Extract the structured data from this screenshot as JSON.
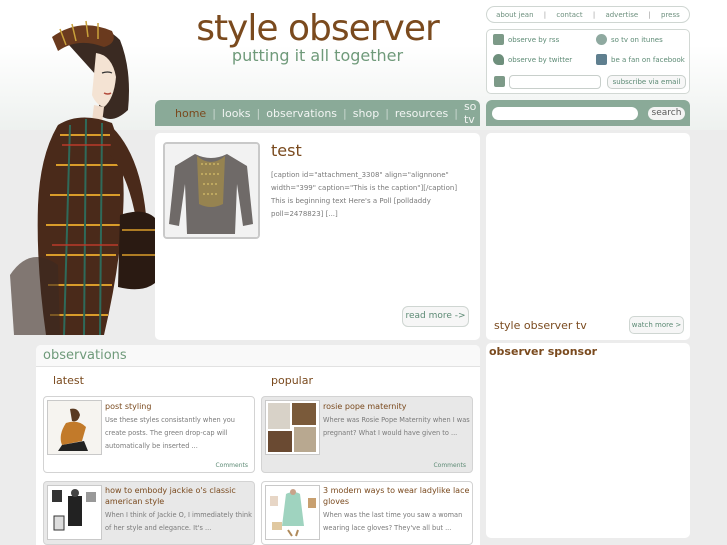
{
  "site": {
    "title": "style observer",
    "tagline": "putting it all together"
  },
  "top_links": [
    "about jean",
    "contact",
    "advertise",
    "press"
  ],
  "social": {
    "rss": "observe by rss",
    "itunes": "so tv on itunes",
    "twitter": "observe by twitter",
    "facebook": "be a fan on facebook",
    "subscribe_button": "subscribe via email"
  },
  "nav": {
    "items": [
      "home",
      "looks",
      "observations",
      "shop",
      "resources",
      "so tv"
    ],
    "active": "home"
  },
  "search": {
    "button": "search"
  },
  "featured": {
    "title": "test",
    "excerpt": "[caption id=\"attachment_3308\" align=\"alignnone\" width=\"399\" caption=\"This is the caption\"][/caption] This is beginning text Here's a Poll [polldaddy poll=2478823] [...]",
    "read_more": "read more ->"
  },
  "tv": {
    "title": "style observer tv",
    "watch_more": "watch more >"
  },
  "sponsor": {
    "title": "observer sponsor"
  },
  "observations": {
    "title": "observations",
    "latest_label": "latest",
    "popular_label": "popular",
    "latest": [
      {
        "title": "post styling",
        "excerpt": "Use these styles consistantly when you create posts. The green drop-cap will automatically be inserted ...",
        "comments": "Comments"
      },
      {
        "title": "how to embody jackie o's classic american style",
        "excerpt": "When I think of Jackie O, I immediately think of her style and elegance. It's ...",
        "comments": "Comments"
      }
    ],
    "popular": [
      {
        "title": "rosie pope maternity",
        "excerpt": "Where was Rosie Pope Maternity when I was pregnant? What I would have given to ...",
        "comments": "Comments"
      },
      {
        "title": "3 modern ways to wear ladylike lace gloves",
        "excerpt": "When was the last time you saw a woman wearing lace gloves? They've all but ...",
        "comments": "Comments"
      }
    ]
  },
  "colors": {
    "brown": "#7a4a1e",
    "sage": "#8aaa98",
    "green_text": "#6f9a7a",
    "background": "#ececec"
  }
}
